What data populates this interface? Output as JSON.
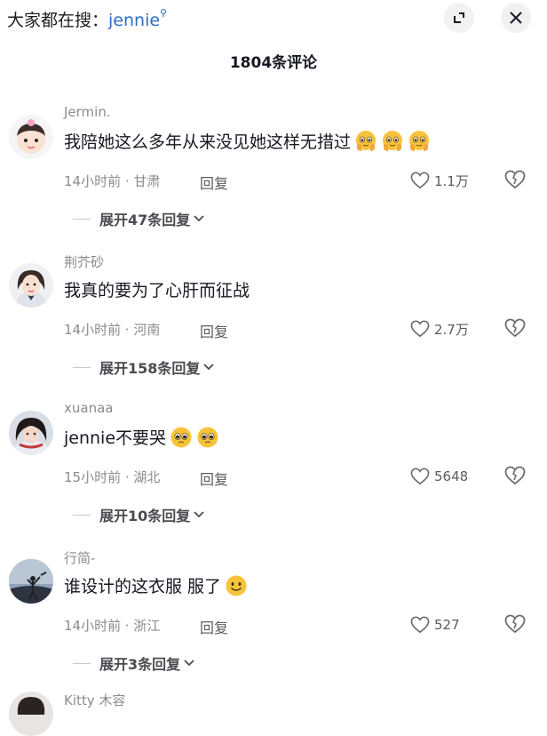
{
  "header": {
    "search_prefix": "大家都在搜：",
    "search_keyword": "jennie",
    "search_icon": "magnifier-icon",
    "expand_icon": "fullscreen-icon",
    "close_icon": "close-icon"
  },
  "comment_count": "1804条评论",
  "comments": [
    {
      "username": "Jermin.",
      "text": "我陪她这么多年从来没见她这样无措过",
      "emoji": [
        "pleading-face-hands",
        "pleading-face-hands",
        "pleading-face-hands"
      ],
      "time": "14小时前",
      "location": "甘肃",
      "meta": "14小时前 · 甘肃",
      "reply_label": "回复",
      "likes": "1.1万",
      "expand_label": "展开47条回复"
    },
    {
      "username": "荆芥砂",
      "text": "我真的要为了心肝而征战",
      "emoji": [],
      "time": "14小时前",
      "location": "河南",
      "meta": "14小时前 · 河南",
      "reply_label": "回复",
      "likes": "2.7万",
      "expand_label": "展开158条回复"
    },
    {
      "username": "xuanaa",
      "text": "jennie不要哭",
      "emoji": [
        "pleading-face",
        "pleading-face"
      ],
      "time": "15小时前",
      "location": "湖北",
      "meta": "15小时前 · 湖北",
      "reply_label": "回复",
      "likes": "5648",
      "expand_label": "展开10条回复"
    },
    {
      "username": "行简-",
      "text": "谁设计的这衣服 服了",
      "emoji": [
        "smiling-face"
      ],
      "time": "14小时前",
      "location": "浙江",
      "meta": "14小时前 · 浙江",
      "reply_label": "回复",
      "likes": "527",
      "expand_label": "展开3条回复"
    }
  ],
  "partial_comment": {
    "username": "Kitty 木容"
  },
  "colors": {
    "link": "#2f6bc7",
    "muted": "#8a8b91",
    "text": "#161823",
    "emoji": "#f7c33a"
  }
}
